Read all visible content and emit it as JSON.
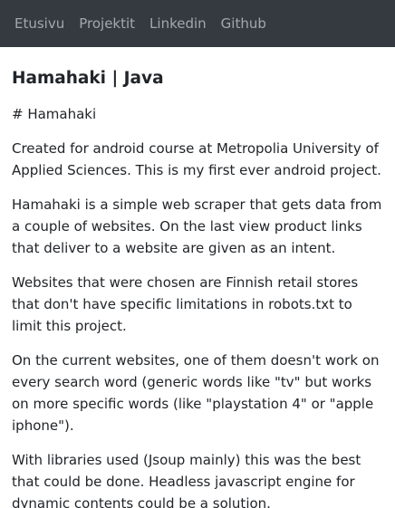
{
  "nav": {
    "items": [
      {
        "label": "Etusivu"
      },
      {
        "label": "Projektit"
      },
      {
        "label": "Linkedin"
      },
      {
        "label": "Github"
      }
    ]
  },
  "article": {
    "title": "Hamahaki | Java",
    "markdown_heading": "# Hamahaki",
    "paragraphs": [
      "Created for android course at Metropolia University of Applied Sciences. This is my first ever android project.",
      "Hamahaki is a simple web scraper that gets data from a couple of websites. On the last view product links that deliver to a website are given as an intent.",
      "Websites that were chosen are Finnish retail stores that don't have specific limitations in robots.txt to limit this project.",
      "On the current websites, one of them doesn't work on every search word (generic words like \"tv\" but works on more specific words (like \"playstation 4\" or \"apple iphone\").",
      "With libraries used (Jsoup mainly) this was the best that could be done. Headless javascript engine for dynamic contents could be a solution."
    ]
  },
  "colors": {
    "navbar_bg": "#343a40",
    "nav_text": "#a7a9ab",
    "body_text": "#212529"
  }
}
